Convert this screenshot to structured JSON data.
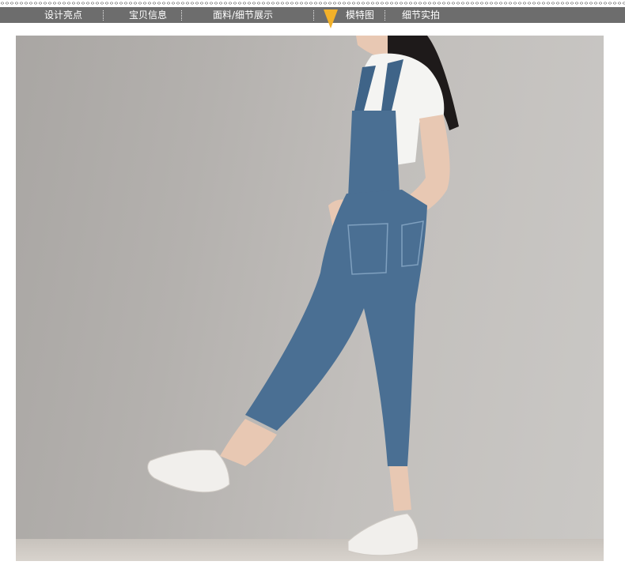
{
  "nav": {
    "items": [
      {
        "label": "设计亮点"
      },
      {
        "label": "宝贝信息"
      },
      {
        "label": "面料/细节展示"
      },
      {
        "label": "模特图"
      },
      {
        "label": "细节实拍"
      }
    ],
    "active_index": 3
  },
  "colors": {
    "nav_background": "#6d6d6d",
    "nav_text": "#ffffff",
    "active_marker": "#f2b12a",
    "wall": "#b4b1ae",
    "denim": "#4a6f93"
  },
  "photo": {
    "icon": "model-photo"
  }
}
